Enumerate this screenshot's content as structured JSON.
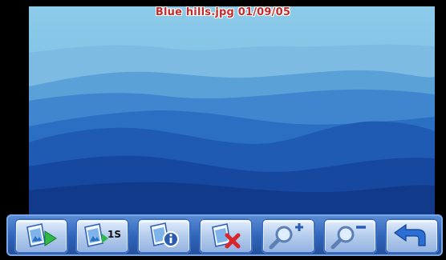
{
  "viewer": {
    "caption": "Blue hills.jpg 01/09/05"
  },
  "toolbar": {
    "buttons": [
      {
        "name": "slideshow-button",
        "icon": "photo-play-icon"
      },
      {
        "name": "slideshow-interval-button",
        "icon": "photo-play-1s-icon",
        "label": "1S"
      },
      {
        "name": "photo-info-button",
        "icon": "photo-info-icon"
      },
      {
        "name": "delete-photo-button",
        "icon": "photo-delete-icon"
      },
      {
        "name": "zoom-in-button",
        "icon": "zoom-in-icon"
      },
      {
        "name": "zoom-out-button",
        "icon": "zoom-out-icon"
      },
      {
        "name": "back-button",
        "icon": "back-arrow-icon"
      }
    ]
  },
  "colors": {
    "caption_text": "#c82a2a",
    "toolbar_blue": "#2f63b8",
    "play_green": "#2fb84a",
    "delete_red": "#d8262a"
  }
}
